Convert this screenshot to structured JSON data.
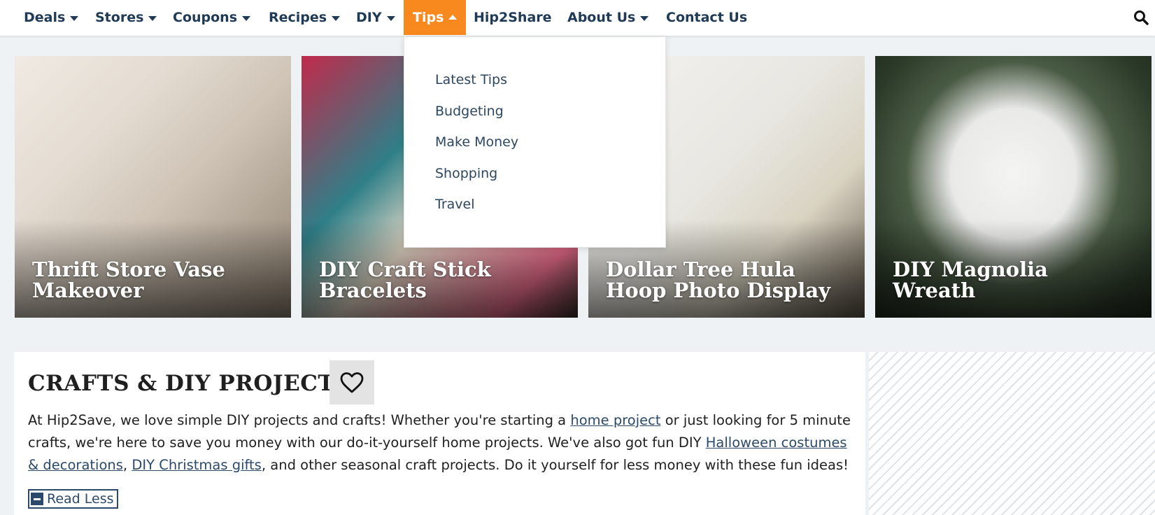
{
  "nav": {
    "items": [
      {
        "label": "Deals",
        "has_caret": true
      },
      {
        "label": "Stores",
        "has_caret": true
      },
      {
        "label": "Coupons",
        "has_caret": true
      },
      {
        "label": "Recipes",
        "has_caret": true
      },
      {
        "label": "DIY",
        "has_caret": true
      },
      {
        "label": "Tips",
        "has_caret": true,
        "active": true
      },
      {
        "label": "Hip2Share",
        "has_caret": false
      },
      {
        "label": "About Us",
        "has_caret": true
      },
      {
        "label": "Contact Us",
        "has_caret": false
      }
    ],
    "search_icon": "search-icon"
  },
  "tips_dropdown": {
    "items": [
      "Latest Tips",
      "Budgeting",
      "Make Money",
      "Shopping",
      "Travel"
    ]
  },
  "cards": [
    {
      "title": "Thrift Store Vase Makeover"
    },
    {
      "title": "DIY Craft Stick Bracelets"
    },
    {
      "title": "Dollar Tree Hula Hoop Photo Display"
    },
    {
      "title": "DIY Magnolia Wreath"
    }
  ],
  "section": {
    "heading": "CRAFTS & DIY PROJECTS",
    "favorite_icon": "heart-icon",
    "desc_1": "At Hip2Save, we love simple DIY projects and crafts! Whether you're starting a ",
    "link_home_project": "home project",
    "desc_2": " or just looking for 5 minute crafts, we're here to save you money with our do-it-yourself home projects. We've also got fun DIY ",
    "link_halloween": "Halloween costumes & decorations",
    "desc_3": ", ",
    "link_christmas": "DIY Christmas gifts",
    "desc_4": ", and other seasonal craft projects. Do it yourself for less money with these fun ideas!",
    "read_less": "Read Less"
  },
  "colors": {
    "nav_text": "#1f3a57",
    "active_tab": "#f7891e",
    "link": "#2b4a6b",
    "page_bg": "#eef2f4"
  }
}
